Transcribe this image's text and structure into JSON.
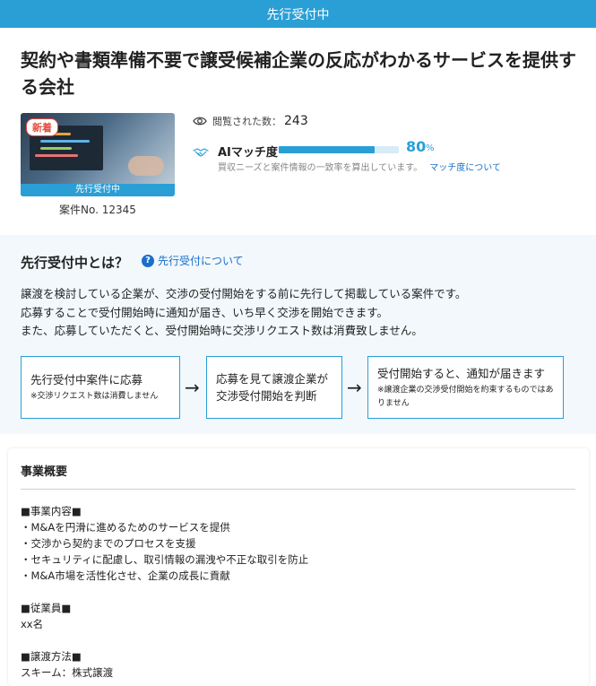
{
  "header": {
    "status": "先行受付中"
  },
  "listing": {
    "title": "契約や書類準備不要で譲受候補企業の反応がわかるサービスを提供する会社",
    "badge_new": "新着",
    "image_status": "先行受付中",
    "case_no": "案件No. 12345",
    "views_label": "閲覧された数：",
    "views_count": "243",
    "match": {
      "label": "AIマッチ度",
      "percent": 80,
      "percent_text": "80",
      "percent_unit": "%",
      "description": "買収ニーズと案件情報の一致率を算出しています。",
      "link": "マッチ度について"
    }
  },
  "pre_reception": {
    "title": "先行受付中とは？",
    "help_link": "先行受付について",
    "description": [
      "譲渡を検討している企業が、交渉の受付開始をする前に先行して掲載している案件です。",
      "応募することで受付開始時に通知が届き、いち早く交渉を開始できます。",
      "また、応募していただくと、受付開始時に交渉リクエスト数は消費致しません。"
    ],
    "steps": [
      {
        "main": "先行受付中案件に応募",
        "note": "※交渉リクエスト数は消費しません"
      },
      {
        "main": "応募を見て譲渡企業が交渉受付開始を判断",
        "note": ""
      },
      {
        "main": "受付開始すると、通知が届きます",
        "note": "※譲渡企業の交渉受付開始を約束するものではありません"
      }
    ],
    "arrow": "→"
  },
  "business": {
    "title": "事業概要",
    "content_heading": "■事業内容■",
    "content_items": [
      "・M&Aを円滑に進めるためのサービスを提供",
      "・交渉から契約までのプロセスを支援",
      "・セキュリティに配慮し、取引情報の漏洩や不正な取引を防止",
      "・M&A市場を活性化させ、企業の成長に貢献"
    ],
    "employees_heading": "■従業員■",
    "employees_value": "xx名",
    "transfer_heading": "■譲渡方法■",
    "transfer_value": "スキーム：株式譲渡"
  },
  "colors": {
    "accent": "#2a9fd6",
    "link": "#1a6fc9",
    "new_badge": "#e24a3b",
    "section_bg": "#f2f8fc"
  },
  "icons": {
    "views": "eye-icon",
    "match": "handshake-icon",
    "help": "question-circle-icon"
  }
}
